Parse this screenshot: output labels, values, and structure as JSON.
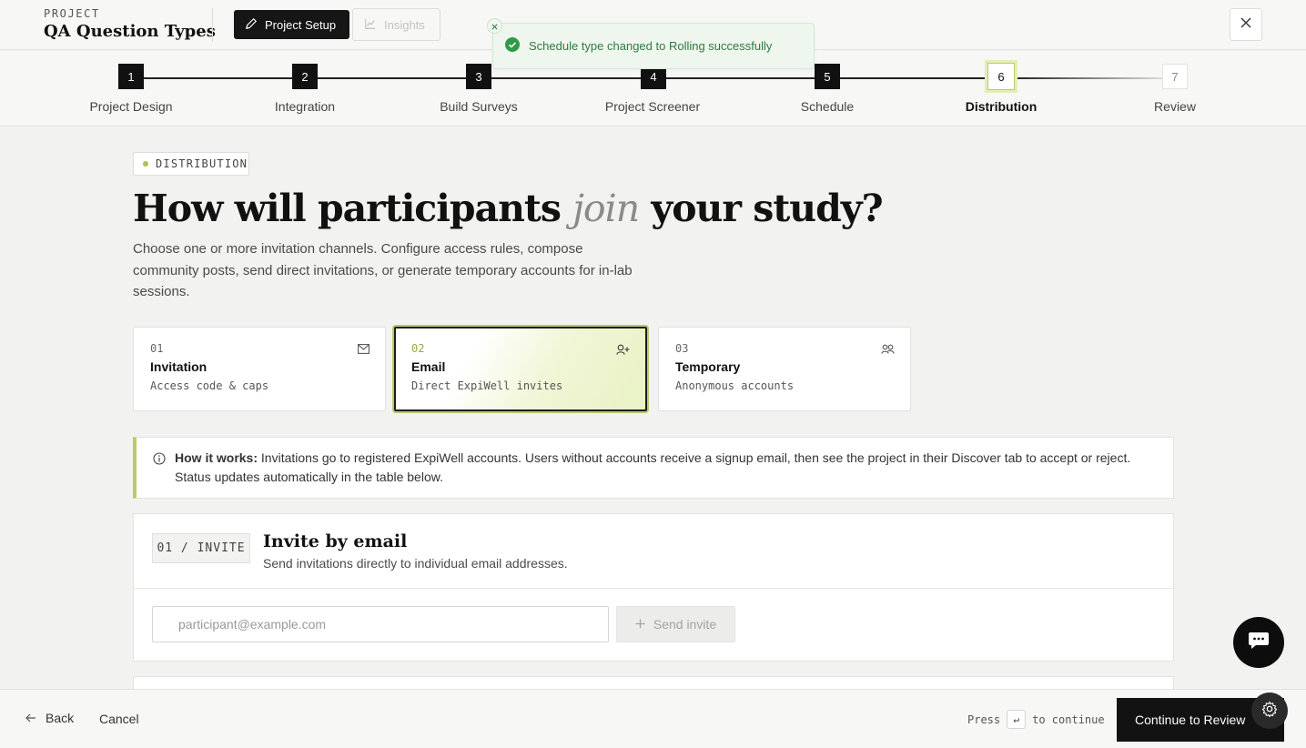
{
  "header": {
    "kicker": "PROJECT",
    "title": "QA Question Types",
    "setup_label": "Project Setup",
    "insights_label": "Insights"
  },
  "toast": {
    "message": "Schedule type changed to Rolling successfully",
    "color": "#2f7a3f"
  },
  "stepper": {
    "current": 6,
    "steps": [
      {
        "num": "1",
        "label": "Project Design"
      },
      {
        "num": "2",
        "label": "Integration"
      },
      {
        "num": "3",
        "label": "Build Surveys"
      },
      {
        "num": "4",
        "label": "Project Screener"
      },
      {
        "num": "5",
        "label": "Schedule"
      },
      {
        "num": "6",
        "label": "Distribution"
      },
      {
        "num": "7",
        "label": "Review"
      }
    ]
  },
  "main": {
    "badge": "DISTRIBUTION",
    "headline_pre": "How will participants",
    "headline_em": "join",
    "headline_post": "your study?",
    "subtext": "Choose one or more invitation channels. Configure access rules, compose community posts, send direct invitations, or generate temporary accounts for in-lab sessions.",
    "channels": [
      {
        "num": "01",
        "title": "Invitation",
        "desc": "Access code & caps",
        "icon": "envelope-icon",
        "selected": false
      },
      {
        "num": "02",
        "title": "Email",
        "desc": "Direct ExpiWell invites",
        "icon": "user-plus-icon",
        "selected": true
      },
      {
        "num": "03",
        "title": "Temporary",
        "desc": "Anonymous accounts",
        "icon": "users-icon",
        "selected": false
      }
    ],
    "info": {
      "label": "How it works:",
      "text": "Invitations go to registered ExpiWell accounts. Users without accounts receive a signup email, then see the project in their Discover tab to accept or reject. Status updates automatically in the table below."
    },
    "invite": {
      "tag": "01 / INVITE",
      "title": "Invite by email",
      "subtitle": "Send invitations directly to individual email addresses.",
      "placeholder": "participant@example.com",
      "value": "",
      "send_label": "Send invite"
    }
  },
  "footer": {
    "back_label": "Back",
    "cancel_label": "Cancel",
    "press_label": "Press",
    "key_label": "↵",
    "continue_hint": "to continue",
    "continue_label": "Continue to Review"
  },
  "colors": {
    "accent": "#b6cc64",
    "primary": "#111111",
    "background": "#f2f2f0"
  }
}
